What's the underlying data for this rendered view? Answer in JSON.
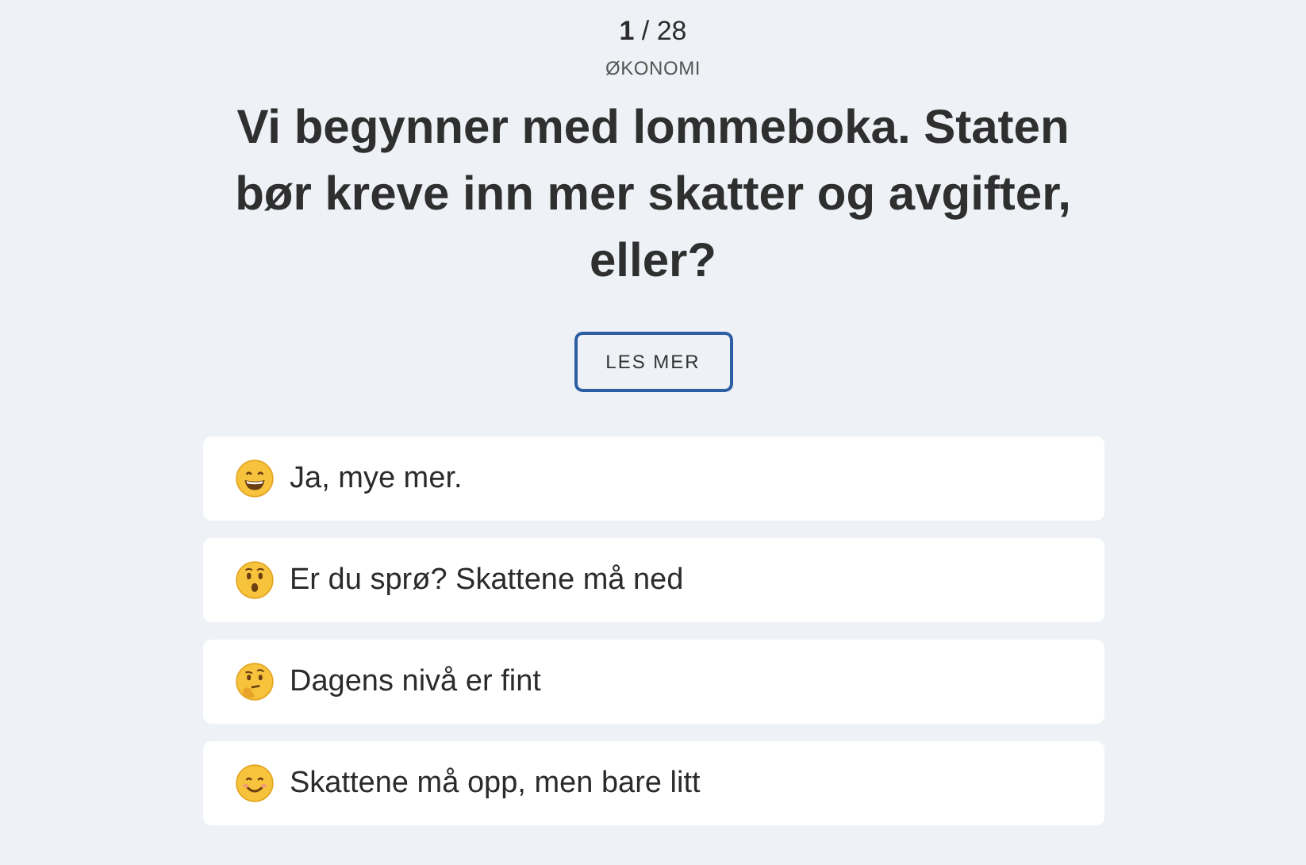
{
  "progress": {
    "current": "1",
    "separator": "/",
    "total": "28"
  },
  "category": "ØKONOMI",
  "question": "Vi begynner med lommeboka. Staten bør kreve inn mer skatter og avgifter, eller?",
  "read_more_button": "LES MER",
  "answers": [
    {
      "label": "Ja, mye mer."
    },
    {
      "label": "Er du sprø? Skattene må ned"
    },
    {
      "label": "Dagens nivå er fint"
    },
    {
      "label": "Skattene må opp, men bare litt"
    }
  ]
}
